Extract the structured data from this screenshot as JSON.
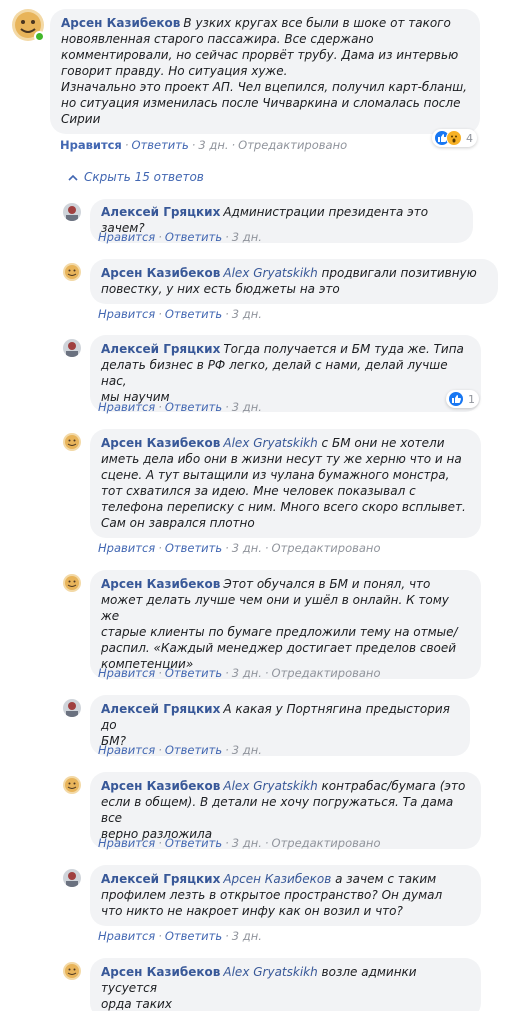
{
  "main_comment": {
    "author": "Арсен Казибеков",
    "text_lines": [
      "В узких кругах все были в шоке от такого",
      "новоявленная старого пассажира. Все сдержано",
      "комментировали, но сейчас прорвёт трубу. Дама из интервью",
      "говорит правду. Но ситуация хуже.",
      "Изначально это проект АП. Чел вцепился, получил карт-бланш,",
      "но ситуация изменилась после Чичваркина и сломалась после",
      "Сирии"
    ],
    "like_label": "Нравится",
    "reply_label": "Ответить",
    "time": "3 дн.",
    "edited": "Отредактировано",
    "reaction_count": "4"
  },
  "replies_toggle": "Скрыть 15 ответов",
  "replies": [
    {
      "author": "Алексей Гряцких",
      "avatar": "aleksey",
      "mention": "",
      "text_lines": [
        "Администрации президента это зачем?"
      ],
      "like_label": "Нравится",
      "reply_label": "Ответить",
      "time": "3 дн.",
      "edited": "",
      "reaction_count": ""
    },
    {
      "author": "Арсен Казибеков",
      "avatar": "arsen",
      "mention": "Alex Gryatskikh",
      "text_lines": [
        "продвигали позитивную",
        "повестку, у них есть бюджеты на это"
      ],
      "like_label": "Нравится",
      "reply_label": "Ответить",
      "time": "3 дн.",
      "edited": "",
      "reaction_count": ""
    },
    {
      "author": "Алексей Гряцких",
      "avatar": "aleksey",
      "mention": "",
      "text_lines": [
        "Тогда получается и БМ туда же. Типа",
        "делать бизнес в РФ легко, делай с нами, делай лучше нас,",
        "мы научим"
      ],
      "like_label": "Нравится",
      "reply_label": "Ответить",
      "time": "3 дн.",
      "edited": "",
      "reaction_count": "1"
    },
    {
      "author": "Арсен Казибеков",
      "avatar": "arsen",
      "mention": "Alex Gryatskikh",
      "text_lines": [
        "с БМ они не хотели",
        "иметь дела ибо они в жизни несут ту же херню что и на",
        "сцене. А тут вытащили из чулана бумажного монстра,",
        "тот схватился за идею. Мне человек показывал с",
        "телефона переписку с ним. Много всего скоро всплывет.",
        "Сам он заврался плотно"
      ],
      "like_label": "Нравится",
      "reply_label": "Ответить",
      "time": "3 дн.",
      "edited": "Отредактировано",
      "reaction_count": ""
    },
    {
      "author": "Арсен Казибеков",
      "avatar": "arsen",
      "mention": "",
      "text_lines": [
        "Этот обучался в БМ и понял, что",
        "может делать лучше чем они и ушёл в онлайн. К тому же",
        "старые клиенты по бумаге предложили тему на отмые/",
        "распил. «Каждый менеджер достигает пределов своей",
        "компетенции»"
      ],
      "like_label": "Нравится",
      "reply_label": "Ответить",
      "time": "3 дн.",
      "edited": "Отредактировано",
      "reaction_count": ""
    },
    {
      "author": "Алексей Гряцких",
      "avatar": "aleksey",
      "mention": "",
      "text_lines": [
        "А какая у Портнягина предыстория до",
        "БМ?"
      ],
      "like_label": "Нравится",
      "reply_label": "Ответить",
      "time": "3 дн.",
      "edited": "",
      "reaction_count": ""
    },
    {
      "author": "Арсен Казибеков",
      "avatar": "arsen",
      "mention": "Alex Gryatskikh",
      "text_lines": [
        "контрабас/бумага (это",
        "если в общем). В детали не хочу погружаться. Та дама все",
        "верно разложила"
      ],
      "like_label": "Нравится",
      "reply_label": "Ответить",
      "time": "3 дн.",
      "edited": "Отредактировано",
      "reaction_count": ""
    },
    {
      "author": "Алексей Гряцких",
      "avatar": "aleksey",
      "mention": "Арсен Казибеков",
      "text_lines": [
        "а зачем с таким",
        "профилем лезть в открытое пространство? Он думал",
        "что никто не накроет инфу как он возил и что?"
      ],
      "like_label": "Нравится",
      "reply_label": "Ответить",
      "time": "3 дн.",
      "edited": "",
      "reaction_count": ""
    },
    {
      "author": "Арсен Казибеков",
      "avatar": "arsen",
      "mention": "Alex Gryatskikh",
      "text_lines": [
        "возле админки тусуется",
        "орда таких"
      ],
      "like_label": "",
      "reply_label": "",
      "time": "",
      "edited": "",
      "reaction_count": ""
    }
  ]
}
